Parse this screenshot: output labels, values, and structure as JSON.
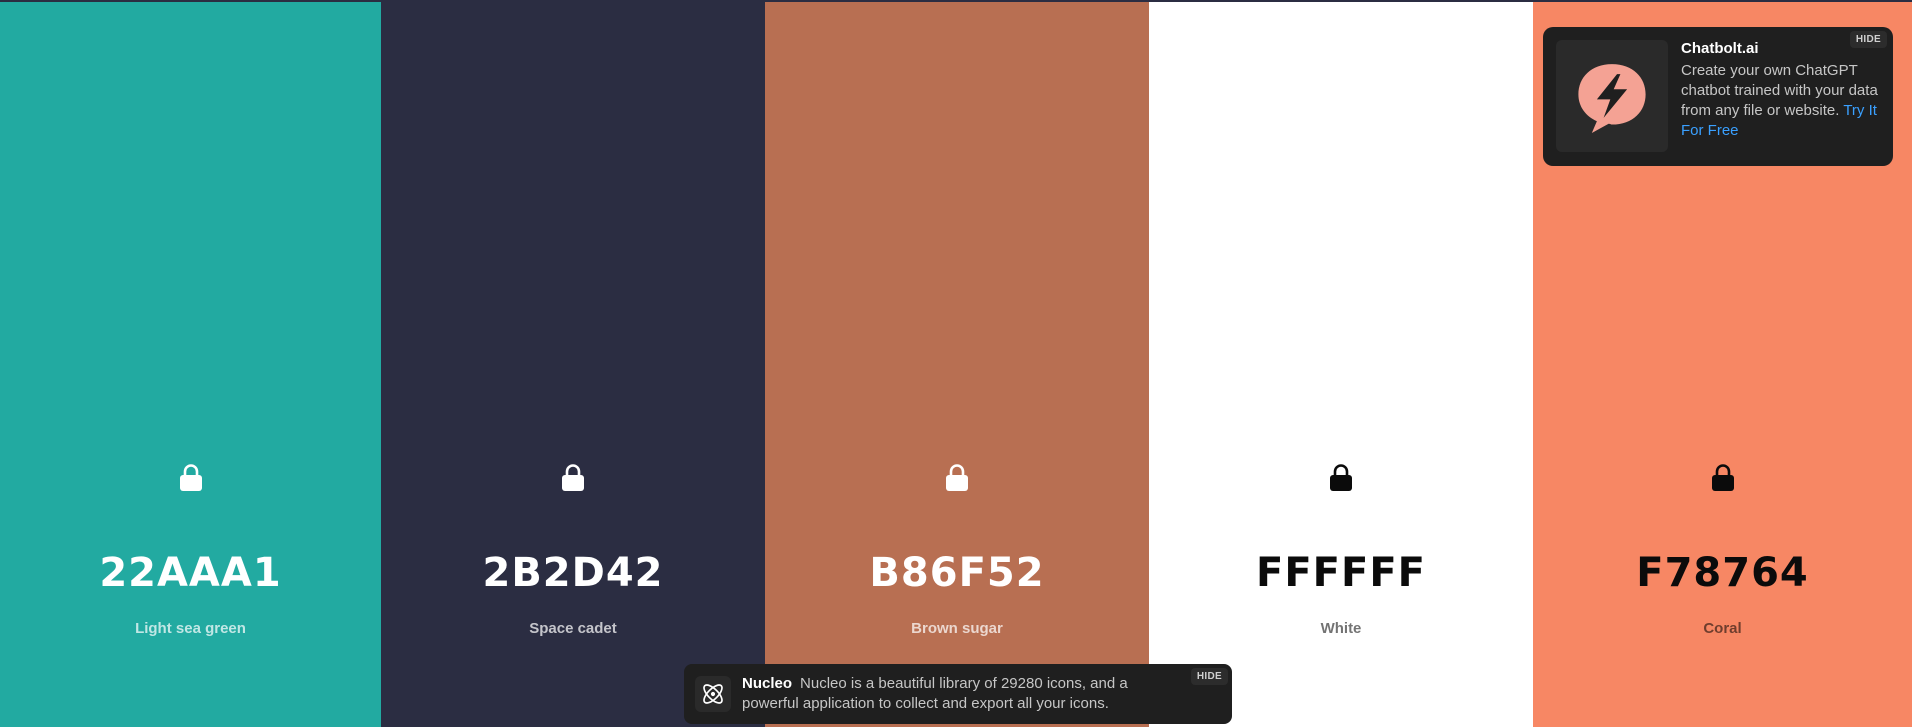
{
  "palette": [
    {
      "hex": "22AAA1",
      "name": "Light sea green",
      "color": "#22aaa1",
      "tone": "light",
      "lock_icon": "lock-icon"
    },
    {
      "hex": "2B2D42",
      "name": "Space cadet",
      "color": "#2b2d42",
      "tone": "light",
      "lock_icon": "lock-icon"
    },
    {
      "hex": "B86F52",
      "name": "Brown sugar",
      "color": "#b86f52",
      "tone": "light",
      "lock_icon": "lock-icon"
    },
    {
      "hex": "FFFFFF",
      "name": "White",
      "color": "#ffffff",
      "tone": "dark",
      "lock_icon": "lock-icon"
    },
    {
      "hex": "F78764",
      "name": "Coral",
      "color": "#f78764",
      "tone": "dark",
      "lock_icon": "lock-icon"
    }
  ],
  "ad_top": {
    "title": "Chatbolt.ai",
    "body": "Create your own ChatGPT chatbot trained with your data from any file or website.",
    "cta": "Try It For Free",
    "hide_label": "HIDE",
    "icon": "chat-bolt-icon"
  },
  "ad_bottom": {
    "brand": "Nucleo",
    "body": "Nucleo is a beautiful library of 29280 icons, and a powerful application to collect and export all your icons.",
    "hide_label": "HIDE",
    "icon": "atom-icon"
  }
}
